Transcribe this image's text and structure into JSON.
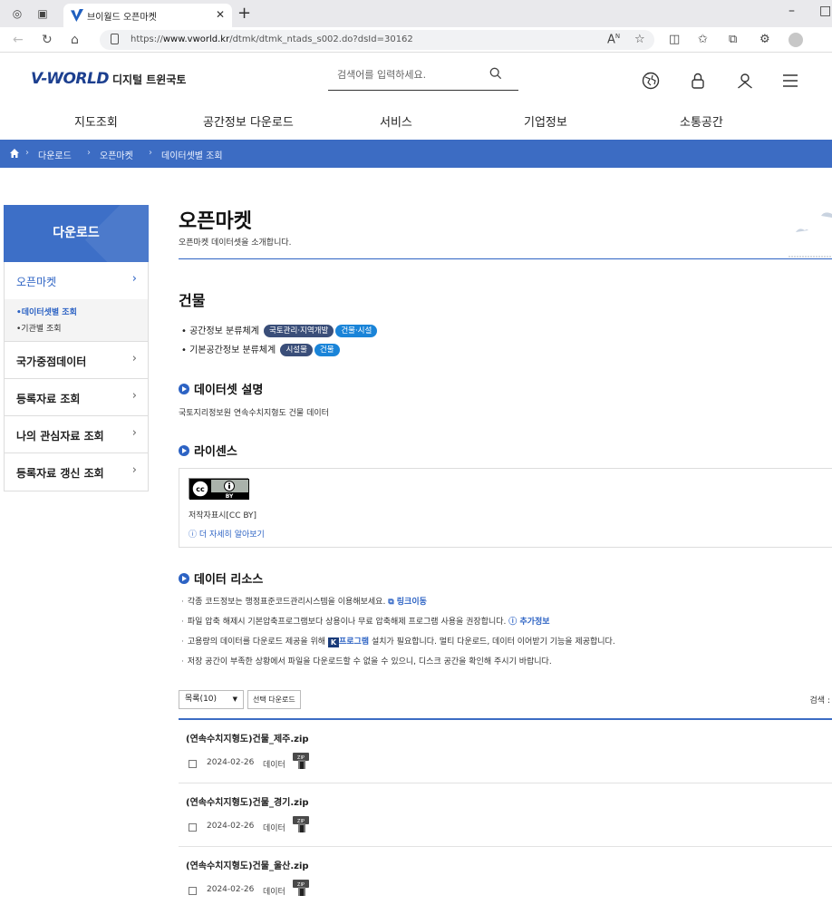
{
  "browser": {
    "tab_title": "브이월드 오픈마켓",
    "url_prefix": "https://",
    "url_domain": "www.vworld.kr",
    "url_path": "/dtmk/dtmk_ntads_s002.do?dsId=30162"
  },
  "header": {
    "logo_main": "V-WORLD",
    "logo_sub": "디지털 트윈국토",
    "search_placeholder": "검색어를 입력하세요."
  },
  "gnb": [
    "지도조회",
    "공간정보 다운로드",
    "서비스",
    "기업정보",
    "소통공간"
  ],
  "breadcrumb": [
    "다운로드",
    "오픈마켓",
    "데이터셋별 조회"
  ],
  "sidebar": {
    "title": "다운로드",
    "active": "오픈마켓",
    "sub_items": [
      "•데이터셋별 조회",
      "•기관별 조회"
    ],
    "items": [
      "국가중점데이터",
      "등록자료 조회",
      "나의 관심자료 조회",
      "등록자료 갱신 조회"
    ]
  },
  "page": {
    "title": "오픈마켓",
    "description": "오픈마켓 데이터셋을 소개합니다."
  },
  "dataset": {
    "name": "건물",
    "classifications": [
      {
        "label": "• 공간정보 분류체계",
        "tags": [
          {
            "text": "국토관리·지역개발",
            "color": "#3a4e79"
          },
          {
            "text": "건물·시설",
            "color": "#1a84d8"
          }
        ]
      },
      {
        "label": "• 기본공간정보 분류체계",
        "tags": [
          {
            "text": "시설물",
            "color": "#3a4e79"
          },
          {
            "text": "건물",
            "color": "#1a84d8"
          }
        ]
      }
    ],
    "desc_heading": "데이터셋 설명",
    "desc_text": "국토지리정보원 연속수치지형도 건물 데이터",
    "license_heading": "라이센스",
    "license_name": "저작자표시[CC BY]",
    "license_more": "ⓘ 더 자세히 알아보기",
    "license_badge": "BY",
    "resource_heading": "데이터 리소스",
    "notes": {
      "n1": "각종 코드정보는 행정표준코드관리시스템을 이용해보세요.",
      "n1_link": "링크이동",
      "n2": "파일 압축 해제시 기본압축프로그램보다 상용이나 무료 압축해제 프로그램 사용을 권장합니다.",
      "n2_link": "추가정보",
      "n3_a": "고용량의 데이터를 다운로드 제공을 위해",
      "n3_link": "프로그램",
      "n3_b": "설치가 필요합니다. 멀티 다운로드, 데이터 이어받기 기능을 제공합니다.",
      "n4": "저장 공간이 부족한 상황에서 파일을 다운로드할 수 없을 수 있으니, 디스크 공간을 확인해 주시기 바랍니다."
    }
  },
  "list": {
    "page_size": "목록(10)",
    "select_download": "선택 다운로드",
    "search_label": "검색 :",
    "files": [
      {
        "name": "(연속수치지형도)건물_제주.zip",
        "date": "2024-02-26",
        "type": "데이터"
      },
      {
        "name": "(연속수치지형도)건물_경기.zip",
        "date": "2024-02-26",
        "type": "데이터"
      },
      {
        "name": "(연속수치지형도)건물_울산.zip",
        "date": "2024-02-26",
        "type": "데이터"
      }
    ]
  }
}
